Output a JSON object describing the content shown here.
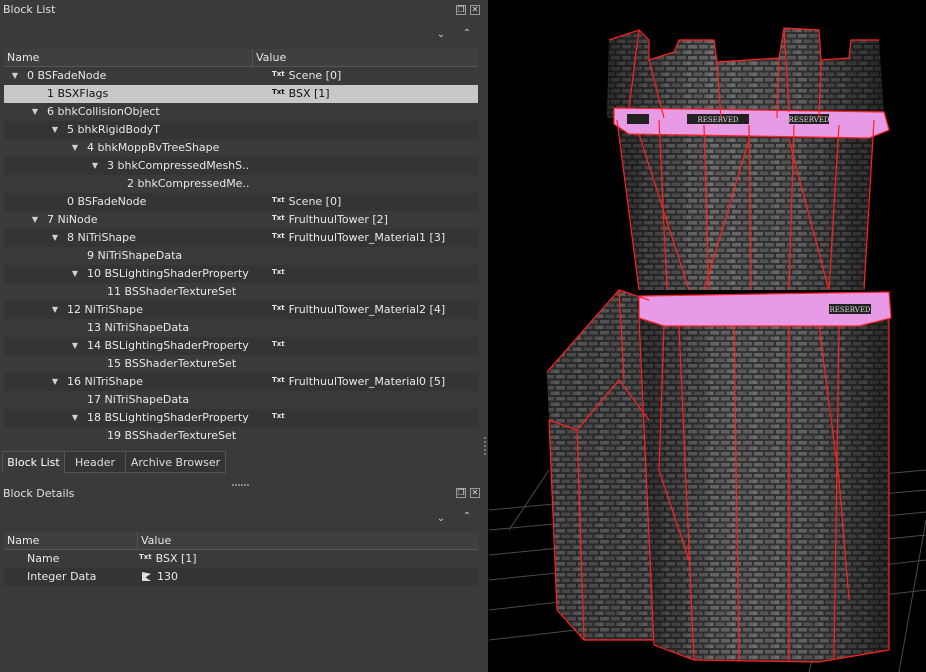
{
  "block_list": {
    "title": "Block List",
    "columns": {
      "name": "Name",
      "value": "Value"
    },
    "rows": [
      {
        "name": "0 BSFadeNode",
        "value": "Scene [0]",
        "txt": true,
        "depth": 0,
        "arrow": true
      },
      {
        "name": "1 BSXFlags",
        "value": "BSX [1]",
        "txt": true,
        "depth": 1,
        "arrow": false,
        "selected": true
      },
      {
        "name": "6 bhkCollisionObject",
        "value": "",
        "txt": false,
        "depth": 1,
        "arrow": true
      },
      {
        "name": "5 bhkRigidBodyT",
        "value": "",
        "txt": false,
        "depth": 2,
        "arrow": true
      },
      {
        "name": "4 bhkMoppBvTreeShape",
        "value": "",
        "txt": false,
        "depth": 3,
        "arrow": true
      },
      {
        "name": "3 bhkCompressedMeshS...",
        "value": "",
        "txt": false,
        "depth": 4,
        "arrow": true
      },
      {
        "name": "2 bhkCompressedMe...",
        "value": "",
        "txt": false,
        "depth": 5,
        "arrow": false
      },
      {
        "name": "0 BSFadeNode",
        "value": "Scene [0]",
        "txt": true,
        "depth": 2,
        "arrow": false
      },
      {
        "name": "7 NiNode",
        "value": "FrulthuulTower [2]",
        "txt": true,
        "depth": 1,
        "arrow": true
      },
      {
        "name": "8 NiTriShape",
        "value": "FrulthuulTower_Material1 [3]",
        "txt": true,
        "depth": 2,
        "arrow": true
      },
      {
        "name": "9 NiTriShapeData",
        "value": "",
        "txt": false,
        "depth": 3,
        "arrow": false
      },
      {
        "name": "10 BSLightingShaderProperty",
        "value": "",
        "txt": true,
        "depth": 3,
        "arrow": true
      },
      {
        "name": "11 BSShaderTextureSet",
        "value": "",
        "txt": false,
        "depth": 4,
        "arrow": false
      },
      {
        "name": "12 NiTriShape",
        "value": "FrulthuulTower_Material2 [4]",
        "txt": true,
        "depth": 2,
        "arrow": true
      },
      {
        "name": "13 NiTriShapeData",
        "value": "",
        "txt": false,
        "depth": 3,
        "arrow": false
      },
      {
        "name": "14 BSLightingShaderProperty",
        "value": "",
        "txt": true,
        "depth": 3,
        "arrow": true
      },
      {
        "name": "15 BSShaderTextureSet",
        "value": "",
        "txt": false,
        "depth": 4,
        "arrow": false
      },
      {
        "name": "16 NiTriShape",
        "value": "FrulthuulTower_Material0 [5]",
        "txt": true,
        "depth": 2,
        "arrow": true
      },
      {
        "name": "17 NiTriShapeData",
        "value": "",
        "txt": false,
        "depth": 3,
        "arrow": false
      },
      {
        "name": "18 BSLightingShaderProperty",
        "value": "",
        "txt": true,
        "depth": 3,
        "arrow": true
      },
      {
        "name": "19 BSShaderTextureSet",
        "value": "",
        "txt": false,
        "depth": 4,
        "arrow": false
      }
    ]
  },
  "tabs": [
    "Block List",
    "Header",
    "Archive Browser"
  ],
  "block_details": {
    "title": "Block Details",
    "columns": {
      "name": "Name",
      "value": "Value"
    },
    "rows": [
      {
        "name": "Name",
        "value": "BSX [1]",
        "icon": "txt-icon"
      },
      {
        "name": "Integer Data",
        "value": "130",
        "icon": "flag-icon"
      }
    ]
  },
  "txt_icon_label": "Txt",
  "viewport": {
    "model": "tower",
    "banner_text": "RESERVED",
    "colors": {
      "wireframe": "#ff2020",
      "banner": "#e79be7",
      "grid": "#5a5a5a",
      "stone": "#6a6a6a"
    }
  }
}
